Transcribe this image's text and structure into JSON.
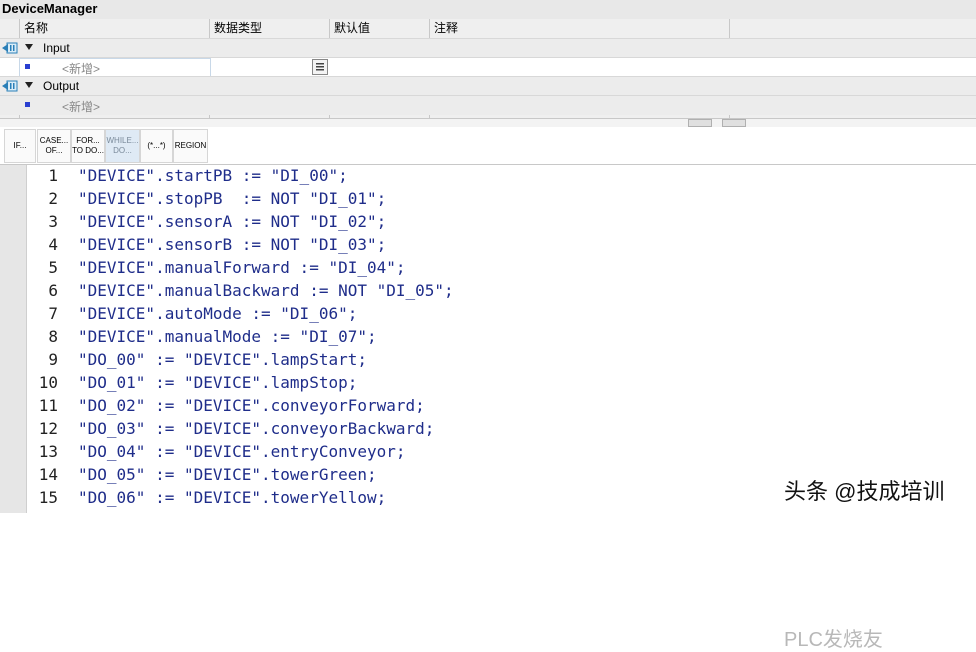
{
  "window": {
    "title": "DeviceManager"
  },
  "table": {
    "headers": [
      "名称",
      "数据类型",
      "默认值",
      "注释"
    ],
    "sections": [
      {
        "label": "Input",
        "add_placeholder": "<新增>"
      },
      {
        "label": "Output",
        "add_placeholder": "<新增>"
      }
    ]
  },
  "toolbar": {
    "buttons": [
      {
        "label": "IF..."
      },
      {
        "label": "CASE... OF..."
      },
      {
        "label": "FOR... TO DO..."
      },
      {
        "label": "WHILE... DO..."
      },
      {
        "label": "(*...*)"
      },
      {
        "label": "REGION"
      }
    ]
  },
  "code": {
    "lines": [
      {
        "num": "1",
        "text": "\"DEVICE\".startPB := \"DI_00\";"
      },
      {
        "num": "2",
        "text": "\"DEVICE\".stopPB  := NOT \"DI_01\";"
      },
      {
        "num": "3",
        "text": "\"DEVICE\".sensorA := NOT \"DI_02\";"
      },
      {
        "num": "4",
        "text": "\"DEVICE\".sensorB := NOT \"DI_03\";"
      },
      {
        "num": "5",
        "text": "\"DEVICE\".manualForward := \"DI_04\";"
      },
      {
        "num": "6",
        "text": "\"DEVICE\".manualBackward := NOT \"DI_05\";"
      },
      {
        "num": "7",
        "text": "\"DEVICE\".autoMode := \"DI_06\";"
      },
      {
        "num": "8",
        "text": "\"DEVICE\".manualMode := \"DI_07\";"
      },
      {
        "num": "9",
        "text": "\"DO_00\" := \"DEVICE\".lampStart;"
      },
      {
        "num": "10",
        "text": "\"DO_01\" := \"DEVICE\".lampStop;"
      },
      {
        "num": "11",
        "text": "\"DO_02\" := \"DEVICE\".conveyorForward;"
      },
      {
        "num": "12",
        "text": "\"DO_03\" := \"DEVICE\".conveyorBackward;"
      },
      {
        "num": "13",
        "text": "\"DO_04\" := \"DEVICE\".entryConveyor;"
      },
      {
        "num": "14",
        "text": "\"DO_05\" := \"DEVICE\".towerGreen;"
      },
      {
        "num": "15",
        "text": "\"DO_06\" := \"DEVICE\".towerYellow;"
      }
    ]
  },
  "overlay": {
    "watermark": "PLC发烧友",
    "credit": "头条 @技成培训"
  }
}
